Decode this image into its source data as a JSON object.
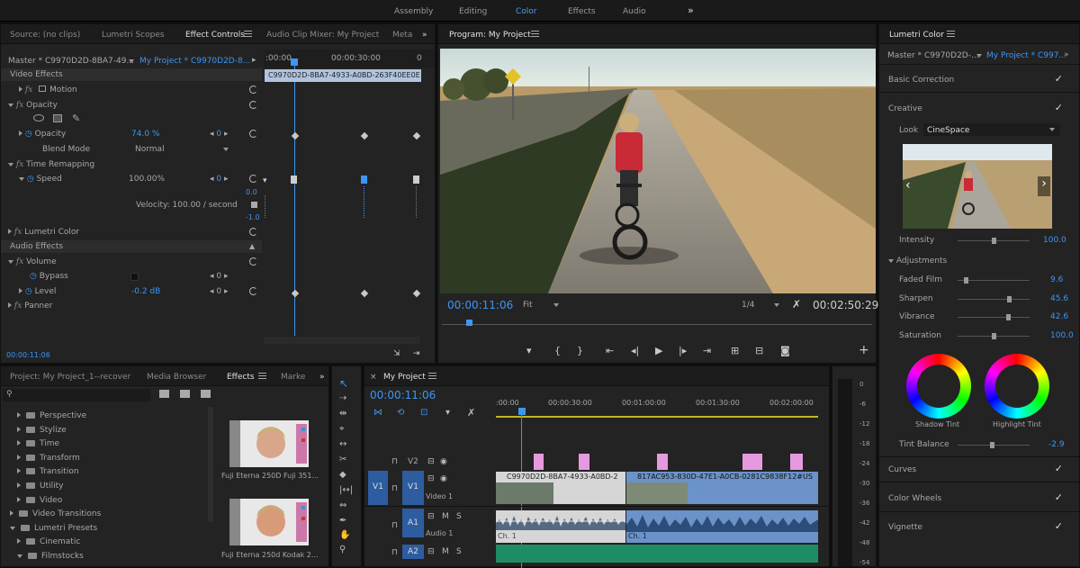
{
  "workspaces": [
    "Assembly",
    "Editing",
    "Color",
    "Effects",
    "Audio"
  ],
  "workspace_active": "Color",
  "workspace_more": "»",
  "effect_controls": {
    "tabs": [
      "Source: (no clips)",
      "Lumetri Scopes",
      "Effect Controls",
      "Audio Clip Mixer: My Project",
      "Meta"
    ],
    "master_label": "Master * C9970D2D-8BA7-49...",
    "sequence_label": "My Project * C9970D2D-8...",
    "clip_name": "C9970D2D-8BA7-4933-A0BD-263F40EE0E",
    "ruler": [
      ":00:00",
      "00:00:30:00",
      "0"
    ],
    "video_effects": "Video Effects",
    "motion": "Motion",
    "opacity": "Opacity",
    "opacity_label": "Opacity",
    "opacity_value": "74.0 %",
    "opacity_kf": "0",
    "blend_mode": "Blend Mode",
    "blend_value": "Normal",
    "time_remapping": "Time Remapping",
    "speed": "Speed",
    "speed_value": "100.00%",
    "speed_kf": "0",
    "velocity": "Velocity: 100.00 / second",
    "vel_top": "0.0",
    "vel_bottom": "-1.0",
    "lumetri": "Lumetri Color",
    "audio_effects": "Audio Effects",
    "volume": "Volume",
    "bypass": "Bypass",
    "bypass_kf": "0",
    "level": "Level",
    "level_value": "-0.2 dB",
    "level_kf": "0",
    "panner": "Panner",
    "timecode": "00:00:11:06"
  },
  "program": {
    "title": "Program: My Project",
    "timecode": "00:00:11:06",
    "fit": "Fit",
    "quality": "1/4",
    "duration": "00:02:50:29"
  },
  "lumetri": {
    "title": "Lumetri Color",
    "master": "Master * C9970D2D-...",
    "sequence": "My Project * C997...",
    "basic": "Basic Correction",
    "creative": "Creative",
    "look_label": "Look",
    "look_value": "CineSpace",
    "intensity_label": "Intensity",
    "intensity_value": "100.0",
    "adjustments": "Adjustments",
    "sliders": [
      {
        "label": "Faded Film",
        "value": "9.6",
        "level": 0.096
      },
      {
        "label": "Sharpen",
        "value": "45.6",
        "level": 0.728
      },
      {
        "label": "Vibrance",
        "value": "42.6",
        "level": 0.713
      },
      {
        "label": "Saturation",
        "value": "100.0",
        "level": 0.5
      }
    ],
    "shadow_tint": "Shadow Tint",
    "highlight_tint": "Highlight Tint",
    "tint_balance_label": "Tint Balance",
    "tint_balance_value": "-2.9",
    "curves": "Curves",
    "color_wheels": "Color Wheels",
    "vignette": "Vignette"
  },
  "effects_panel": {
    "tabs": [
      "Project: My Project_1--recover",
      "Media Browser",
      "Effects",
      "Marke"
    ],
    "tree": [
      {
        "label": "Perspective",
        "indent": 1
      },
      {
        "label": "Stylize",
        "indent": 1
      },
      {
        "label": "Time",
        "indent": 1
      },
      {
        "label": "Transform",
        "indent": 1
      },
      {
        "label": "Transition",
        "indent": 1
      },
      {
        "label": "Utility",
        "indent": 1
      },
      {
        "label": "Video",
        "indent": 1
      },
      {
        "label": "Video Transitions",
        "indent": 0
      },
      {
        "label": "Lumetri Presets",
        "indent": 0
      },
      {
        "label": "Cinematic",
        "indent": 1
      },
      {
        "label": "Filmstocks",
        "indent": 1
      }
    ],
    "preview1": "Fuji Eterna 250D Fuji 351...",
    "preview2": "Fuji Eterna 250d Kodak 2..."
  },
  "timeline": {
    "title": "My Project",
    "timecode": "00:00:11:06",
    "ruler": [
      ":00:00",
      "00:00:30:00",
      "00:01:00:00",
      "00:01:30:00",
      "00:02:00:00"
    ],
    "v2": "V2",
    "v1": "V1",
    "v1_src": "V1",
    "video1": "Video 1",
    "a1": "A1",
    "audio1": "Audio 1",
    "a2": "A2",
    "m": "M",
    "s": "S",
    "clip1": "C9970D2D-8BA7-4933-A0BD-2",
    "clip2": "817AC953-830D-47E1-A0CB-0281C9838F12#US",
    "ch": "Ch. 1",
    "ch2": "Ch. 1"
  },
  "meter": [
    "0",
    "-6",
    "-12",
    "-18",
    "-24",
    "-30",
    "-36",
    "-42",
    "-48",
    "-54"
  ]
}
